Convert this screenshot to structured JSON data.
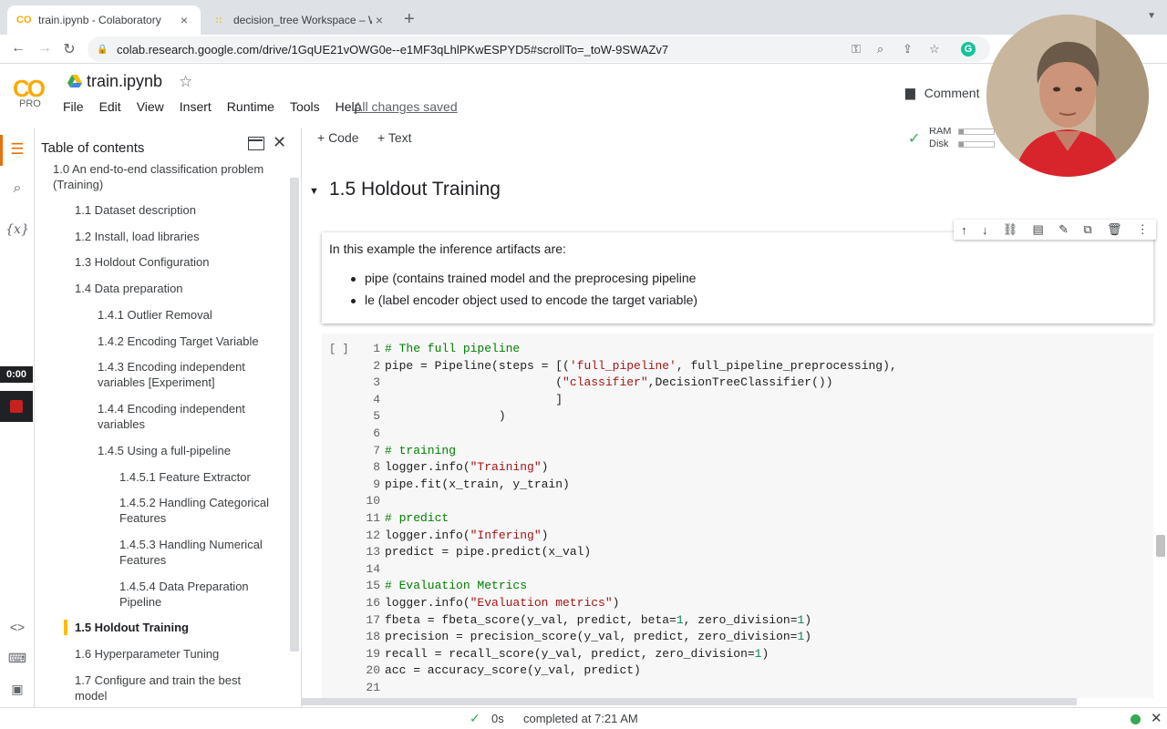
{
  "browser": {
    "tabs": [
      {
        "label": "train.ipynb - Colaboratory",
        "favicon": "CO"
      },
      {
        "label": "decision_tree Workspace – We",
        "favicon": "::"
      }
    ],
    "url": "colab.research.google.com/drive/1GqUE21vOWG0e--e1MF3qLhlPKwESPYD5#scrollTo=_toW-9SWAZv7",
    "grammarly": "G"
  },
  "colab": {
    "logo": "CO",
    "pro_label": "PRO",
    "notebook_title": "train.ipynb",
    "menu": [
      "File",
      "Edit",
      "View",
      "Insert",
      "Runtime",
      "Tools",
      "Help"
    ],
    "save_status": "All changes saved",
    "comment_label": "Comment",
    "toolbar": {
      "add_code": "+ Code",
      "add_text": "+ Text",
      "ram_label": "RAM",
      "disk_label": "Disk"
    }
  },
  "rail": {
    "timer": "0:00",
    "variables_glyph": "{x}"
  },
  "toc": {
    "title": "Table of contents",
    "items": [
      {
        "label": "1.0 An end-to-end classification problem (Training)"
      },
      {
        "label": "1.1 Dataset description"
      },
      {
        "label": "1.2 Install, load libraries"
      },
      {
        "label": "1.3 Holdout Configuration"
      },
      {
        "label": "1.4 Data preparation"
      },
      {
        "label": "1.4.1 Outlier Removal"
      },
      {
        "label": "1.4.2 Encoding Target Variable"
      },
      {
        "label": "1.4.3 Encoding independent variables [Experiment]"
      },
      {
        "label": "1.4.4 Encoding independent variables"
      },
      {
        "label": "1.4.5 Using a full-pipeline"
      },
      {
        "label": "1.4.5.1 Feature Extractor"
      },
      {
        "label": "1.4.5.2 Handling Categorical Features"
      },
      {
        "label": "1.4.5.3 Handling Numerical Features"
      },
      {
        "label": "1.4.5.4 Data Preparation Pipeline"
      },
      {
        "label": "1.5 Holdout Training"
      },
      {
        "label": "1.6 Hyperparameter Tuning"
      },
      {
        "label": "1.7 Configure and train the best model"
      }
    ]
  },
  "section": {
    "title": "1.5 Holdout Training"
  },
  "text_cell": {
    "paragraph": "In this example the inference artifacts are:",
    "bullets": [
      "pipe (contains trained model and the preprocesing pipeline",
      "le (label encoder object used to encode the target variable)"
    ]
  },
  "code_cell": {
    "run_label": "[ ]",
    "lines": [
      {
        "n": "1",
        "text": "# The full pipeline"
      },
      {
        "n": "2",
        "text": "pipe = Pipeline(steps = [('full_pipeline', full_pipeline_preprocessing),"
      },
      {
        "n": "3",
        "text": "                        (\"classifier\",DecisionTreeClassifier())"
      },
      {
        "n": "4",
        "text": "                        ]"
      },
      {
        "n": "5",
        "text": "                )"
      },
      {
        "n": "6",
        "text": ""
      },
      {
        "n": "7",
        "text": "# training"
      },
      {
        "n": "8",
        "text": "logger.info(\"Training\")"
      },
      {
        "n": "9",
        "text": "pipe.fit(x_train, y_train)"
      },
      {
        "n": "10",
        "text": ""
      },
      {
        "n": "11",
        "text": "# predict"
      },
      {
        "n": "12",
        "text": "logger.info(\"Infering\")"
      },
      {
        "n": "13",
        "text": "predict = pipe.predict(x_val)"
      },
      {
        "n": "14",
        "text": ""
      },
      {
        "n": "15",
        "text": "# Evaluation Metrics"
      },
      {
        "n": "16",
        "text": "logger.info(\"Evaluation metrics\")"
      },
      {
        "n": "17",
        "text": "fbeta = fbeta_score(y_val, predict, beta=1, zero_division=1)"
      },
      {
        "n": "18",
        "text": "precision = precision_score(y_val, predict, zero_division=1)"
      },
      {
        "n": "19",
        "text": "recall = recall_score(y_val, predict, zero_division=1)"
      },
      {
        "n": "20",
        "text": "acc = accuracy_score(y_val, predict)"
      },
      {
        "n": "21",
        "text": ""
      }
    ]
  },
  "status": {
    "duration": "0s",
    "completed": "completed at 7:21 AM"
  },
  "colors": {
    "accent_orange": "#e8710a",
    "toc_marker": "#fbbc04",
    "ok_green": "#34a853",
    "comment_green": "#008000",
    "string_red": "#a31515",
    "number_green": "#098658"
  }
}
